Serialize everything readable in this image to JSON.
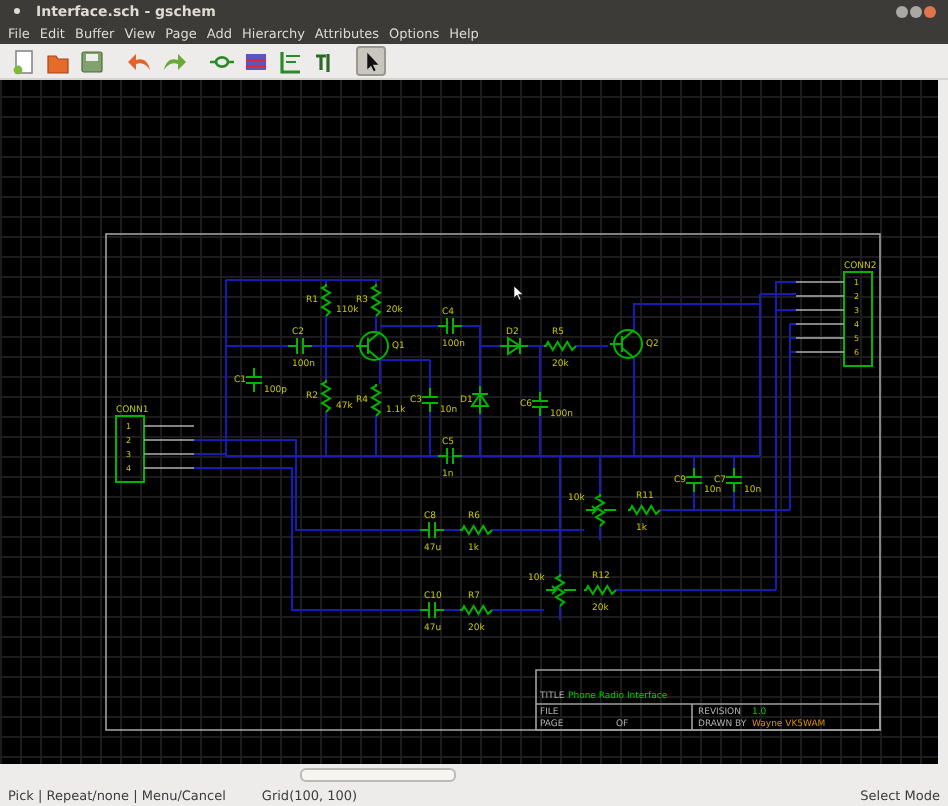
{
  "window": {
    "title": "Interface.sch - gschem"
  },
  "menu": [
    "File",
    "Edit",
    "Buffer",
    "View",
    "Page",
    "Add",
    "Hierarchy",
    "Attributes",
    "Options",
    "Help"
  ],
  "toolbar": [
    {
      "kind": "new",
      "selected": false
    },
    {
      "kind": "open",
      "selected": false
    },
    {
      "kind": "save",
      "selected": false
    },
    {
      "kind": "undo",
      "selected": false
    },
    {
      "kind": "redo",
      "selected": false
    },
    {
      "kind": "component",
      "selected": false
    },
    {
      "kind": "net",
      "selected": false
    },
    {
      "kind": "bus",
      "selected": false
    },
    {
      "kind": "text",
      "selected": false
    },
    {
      "kind": "select",
      "selected": true
    }
  ],
  "schematic": {
    "components": [
      {
        "kind": "capacitor",
        "ref": "C1",
        "value": "100p"
      },
      {
        "kind": "capacitor",
        "ref": "C2",
        "value": "100n"
      },
      {
        "kind": "resistor",
        "ref": "R1",
        "value": "110k"
      },
      {
        "kind": "resistor",
        "ref": "R3",
        "value": "20k"
      },
      {
        "kind": "transistor",
        "ref": "Q1"
      },
      {
        "kind": "resistor",
        "ref": "R2",
        "value": "47k"
      },
      {
        "kind": "resistor",
        "ref": "R4",
        "value": "1.1k"
      },
      {
        "kind": "capacitor",
        "ref": "C4",
        "value": "100n"
      },
      {
        "kind": "capacitor",
        "ref": "C3",
        "value": "10n"
      },
      {
        "kind": "diode",
        "ref": "D1"
      },
      {
        "kind": "capacitor",
        "ref": "C5",
        "value": "1n"
      },
      {
        "kind": "diode",
        "ref": "D2"
      },
      {
        "kind": "resistor",
        "ref": "R5",
        "value": "20k"
      },
      {
        "kind": "transistor",
        "ref": "Q2"
      },
      {
        "kind": "capacitor",
        "ref": "C6",
        "value": "100n"
      },
      {
        "kind": "capacitor",
        "ref": "C8",
        "value": "47u"
      },
      {
        "kind": "resistor",
        "ref": "R6",
        "value": "1k"
      },
      {
        "kind": "capacitor",
        "ref": "C10",
        "value": "47u"
      },
      {
        "kind": "resistor",
        "ref": "R7",
        "value": "20k"
      },
      {
        "kind": "pot",
        "value": "10k"
      },
      {
        "kind": "resistor",
        "ref": "R11",
        "value": "1k"
      },
      {
        "kind": "pot",
        "value": "10k"
      },
      {
        "kind": "resistor",
        "ref": "R12",
        "value": "20k"
      },
      {
        "kind": "capacitor",
        "ref": "C9",
        "value": "10n"
      },
      {
        "kind": "capacitor",
        "ref": "C7",
        "value": "10n"
      }
    ],
    "connectors": [
      {
        "ref": "CONN1",
        "pins": [
          "1",
          "2",
          "3",
          "4"
        ]
      },
      {
        "ref": "CONN2",
        "pins": [
          "1",
          "2",
          "3",
          "4",
          "5",
          "6"
        ]
      }
    ],
    "title_block": {
      "title_label": "TITLE",
      "title": "Phone Radio Interface",
      "file_label": "FILE",
      "page_label": "PAGE",
      "of_label": "OF",
      "revision_label": "REVISION",
      "revision": "1.0",
      "drawn_by_label": "DRAWN BY",
      "drawn_by": "Wayne VK5WAM"
    }
  },
  "status_bar": {
    "hints": "Pick | Repeat/none | Menu/Cancel",
    "grid": "Grid(100, 100)",
    "mode": "Select Mode"
  }
}
